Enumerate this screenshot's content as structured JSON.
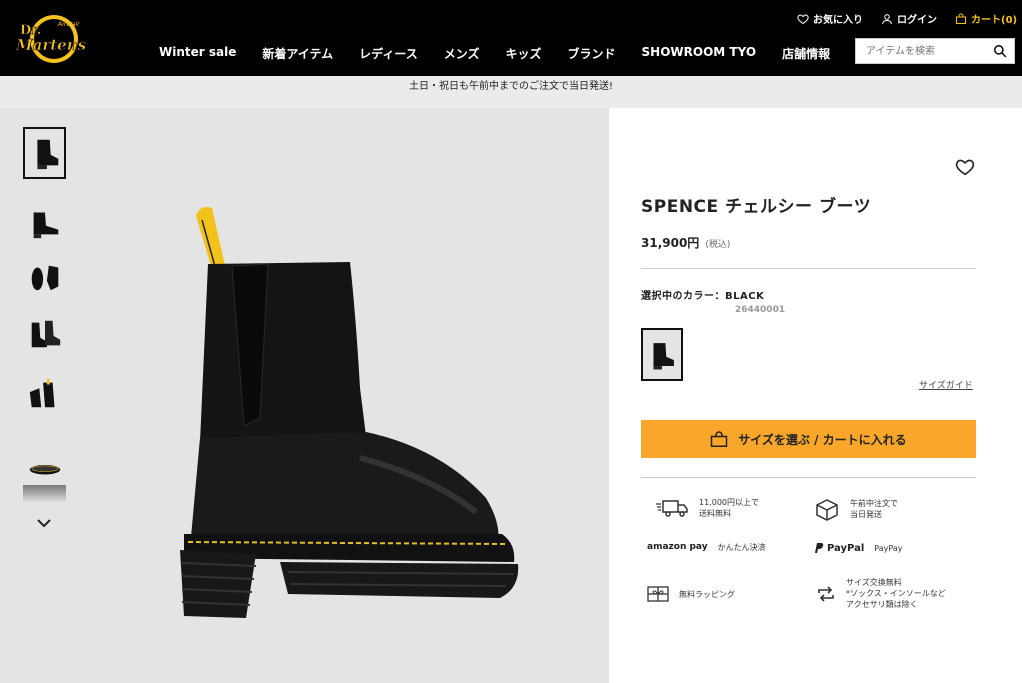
{
  "header": {
    "logo_text": "Dr. Martens AirWair",
    "favorites_label": "お気に入り",
    "login_label": "ログイン",
    "cart_label": "カート(0)",
    "nav": [
      "Winter sale",
      "新着アイテム",
      "レディース",
      "メンズ",
      "キッズ",
      "ブランド",
      "SHOWROOM TYO",
      "店舗情報"
    ],
    "search_placeholder": "アイテムを検索"
  },
  "banner": {
    "text": "土日・祝日も午前中までのご注文で当日発送!"
  },
  "product": {
    "title": "SPENCE チェルシー ブーツ",
    "price": "31,900円",
    "tax_note": "(税込)",
    "color_label": "選択中のカラー：BLACK",
    "sku": "26440001",
    "size_guide": "サイズガイド",
    "cart_button": "サイズを選ぶ / カートに入れる"
  },
  "features": {
    "shipping": "11,000円以上で\n送料無料",
    "same_day": "午前中注文で\n当日発送",
    "amazon_logo": "amazon pay",
    "amazon": "かんたん決済",
    "paypal_logo": "PayPal",
    "paypal": "PayPay",
    "wrapping": "無料ラッピング",
    "exchange": "サイズ交換無料\n*ソックス・インソールなど\nアクセサリ類は除く"
  },
  "colors": {
    "accent": "#f9a62b",
    "header_bg": "#000000",
    "cart_yellow": "#f6c21e"
  }
}
